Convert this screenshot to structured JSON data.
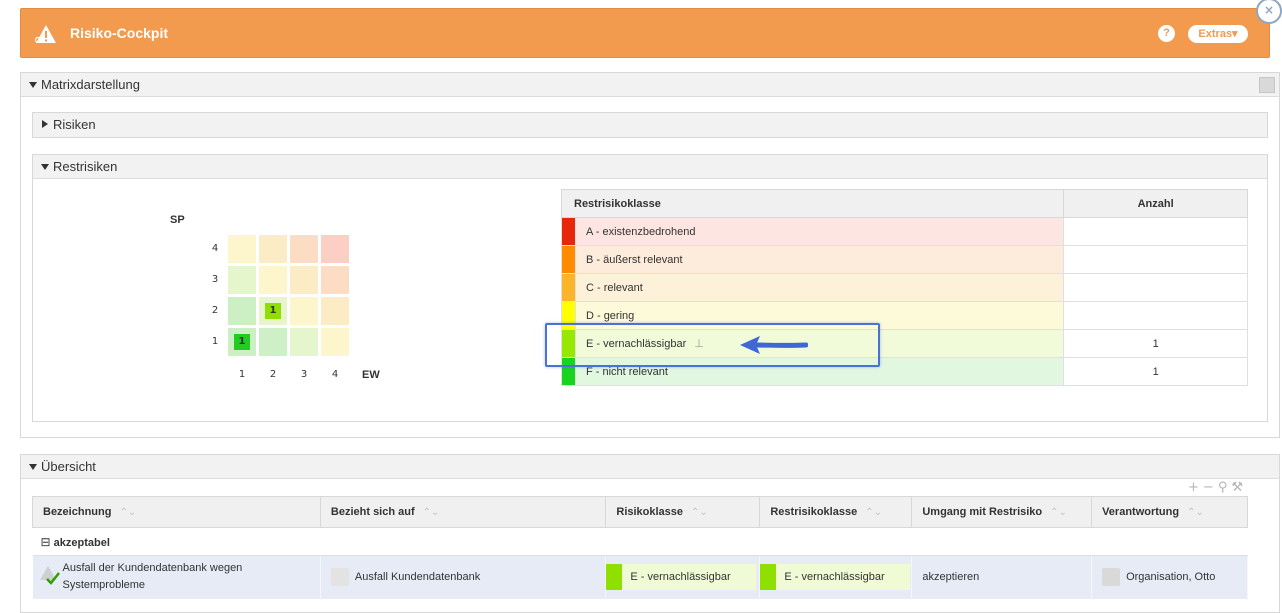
{
  "window": {
    "title": "Risiko-Cockpit",
    "help_label": "?",
    "extras_label": "Extras▾",
    "close_label": "×",
    "icon": "risk-warning-icon"
  },
  "panels": {
    "matrix": "Matrixdarstellung",
    "risiken": "Risiken",
    "restrisiken": "Restrisiken",
    "uebersicht": "Übersicht"
  },
  "matrix": {
    "y_axis_label": "SP",
    "x_axis_label": "EW",
    "y_ticks": [
      "4",
      "3",
      "2",
      "1"
    ],
    "x_ticks": [
      "1",
      "2",
      "3",
      "4"
    ],
    "rows": [
      [
        {
          "color": "#fdf6cc",
          "value": ""
        },
        {
          "color": "#fcecc6",
          "value": ""
        },
        {
          "color": "#fddcc4",
          "value": ""
        },
        {
          "color": "#fccfc4",
          "value": ""
        }
      ],
      [
        {
          "color": "#e5f6cc",
          "value": ""
        },
        {
          "color": "#fdf6cc",
          "value": ""
        },
        {
          "color": "#fcecc6",
          "value": ""
        },
        {
          "color": "#fddcc4",
          "value": ""
        }
      ],
      [
        {
          "color": "#ccf0c4",
          "value": ""
        },
        {
          "color": "#e8f5cc",
          "value": "1"
        },
        {
          "color": "#fdf6cc",
          "value": ""
        },
        {
          "color": "#fcecc6",
          "value": ""
        }
      ],
      [
        {
          "color": "#ccf0c4",
          "value": "1"
        },
        {
          "color": "#cdf0c6",
          "value": ""
        },
        {
          "color": "#e5f6cc",
          "value": ""
        },
        {
          "color": "#fdf6cc",
          "value": ""
        }
      ]
    ],
    "highlight_colors": {
      "E": "#8fe000",
      "F": "#22cc22"
    }
  },
  "restrisiko_table": {
    "headers": [
      "Restrisikoklasse",
      "Anzahl"
    ],
    "rows": [
      {
        "klasse": "A - existenzbedrohend",
        "anzahl": "",
        "color": "#e8260c",
        "bg": "#fde6e2"
      },
      {
        "klasse": "B - äußerst relevant",
        "anzahl": "",
        "color": "#ff8a00",
        "bg": "#fdebdb"
      },
      {
        "klasse": "C - relevant",
        "anzahl": "",
        "color": "#fcb52b",
        "bg": "#fdf1d9"
      },
      {
        "klasse": "D - gering",
        "anzahl": "",
        "color": "#ffff00",
        "bg": "#fdfad9"
      },
      {
        "klasse": "E - vernachlässigbar",
        "anzahl": "1",
        "color": "#97e800",
        "bg": "#f1fbd9"
      },
      {
        "klasse": "F - nicht relevant",
        "anzahl": "1",
        "color": "#17d41e",
        "bg": "#e2f7e0"
      }
    ]
  },
  "overview": {
    "toolbar": {
      "add": "+",
      "remove": "−",
      "search": "⚲",
      "tools": "🔧"
    },
    "headers": [
      "Bezeichnung",
      "Bezieht sich auf",
      "Risikoklasse",
      "Restrisikoklasse",
      "Umgang mit Restrisiko",
      "Verantwortung"
    ],
    "group_label": "akzeptabel",
    "group_toggle": "⊟",
    "row": {
      "bezeichnung": "Ausfall der Kundendatenbank wegen Systemprobleme",
      "bezieht": "Ausfall Kundendatenbank",
      "risikoklasse": "E - vernachlässigbar",
      "restrisikoklasse": "E - vernachlässigbar",
      "umgang": "akzeptieren",
      "verantwortung": "Organisation, Otto"
    }
  }
}
